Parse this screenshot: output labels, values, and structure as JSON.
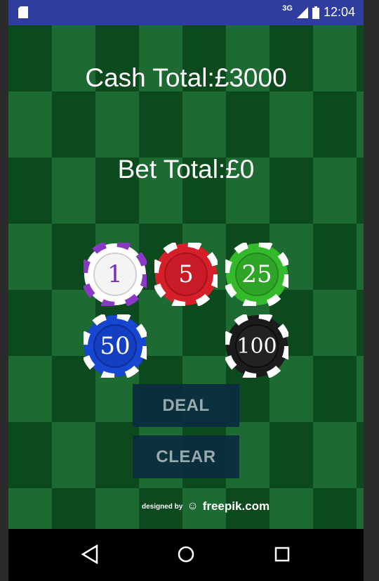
{
  "status_bar": {
    "network": "3G",
    "time": "12:04"
  },
  "cash": {
    "label": "Cash Total:£3000"
  },
  "bet": {
    "label": "Bet Total:£0"
  },
  "chips": [
    {
      "value": "1",
      "color": "#ffffff",
      "accent": "#8a39c6",
      "text_color": "#7a2bb7"
    },
    {
      "value": "5",
      "color": "#d71f2a",
      "accent": "#ffffff",
      "text_color": "#ffffff"
    },
    {
      "value": "25",
      "color": "#34b82c",
      "accent": "#ffffff",
      "text_color": "#ffffff"
    },
    {
      "value": "50",
      "color": "#1746d1",
      "accent": "#ffffff",
      "text_color": "#ffffff"
    },
    {
      "value": "100",
      "color": "#1b1b1b",
      "accent": "#ffffff",
      "text_color": "#ffffff"
    }
  ],
  "buttons": {
    "deal": "DEAL",
    "clear": "CLEAR"
  },
  "credit": {
    "prefix": "designed by",
    "brand": "freepik.com"
  },
  "navigation": {
    "back_icon": "back-triangle-icon",
    "home_icon": "home-circle-icon",
    "recents_icon": "recents-square-icon"
  },
  "colors": {
    "status_bar": "#2f3e9e",
    "felt_dark": "#0c4a1e",
    "felt_light": "#1d6a33",
    "button_bg": "#0b2b40",
    "button_text": "#a8b3bc"
  }
}
